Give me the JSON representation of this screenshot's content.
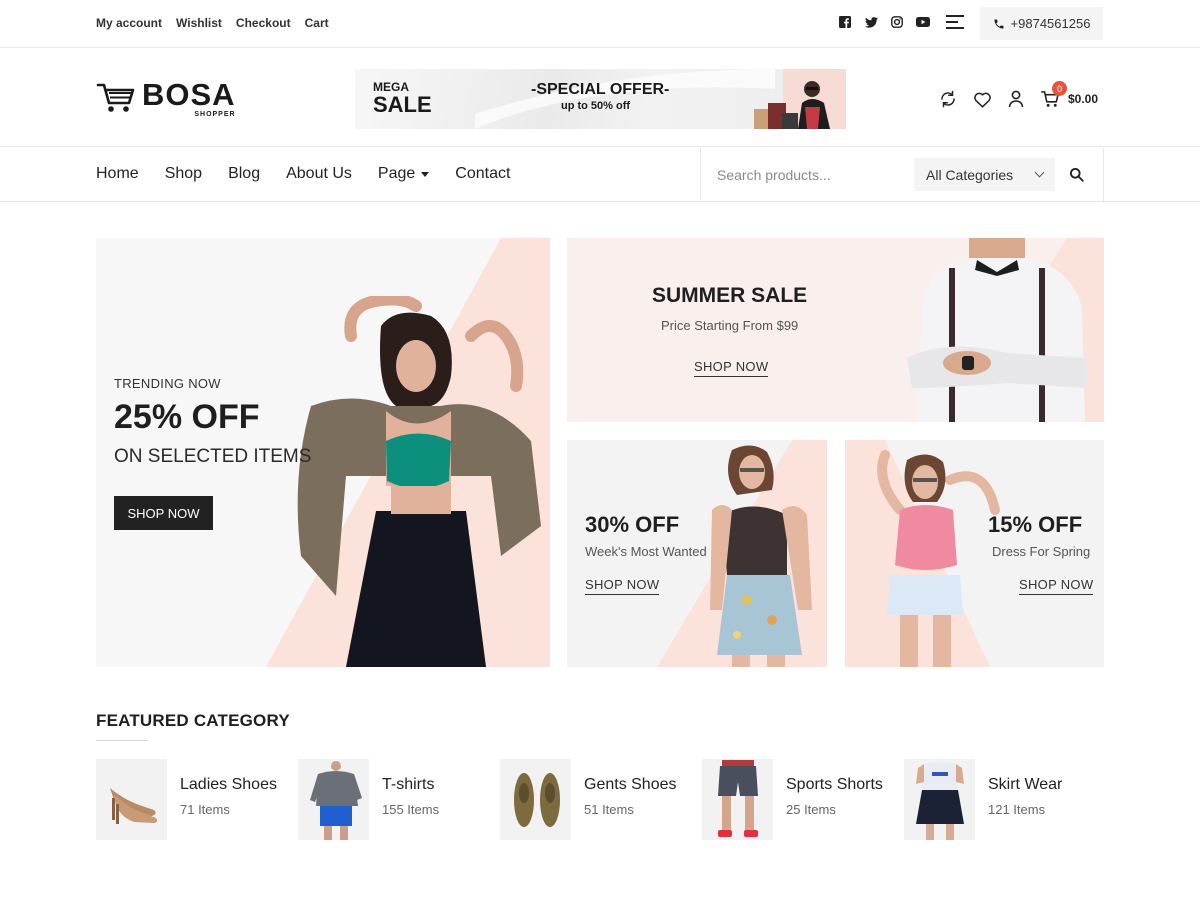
{
  "topbar": {
    "links": [
      "My account",
      "Wishlist",
      "Checkout",
      "Cart"
    ],
    "social_icons": [
      "facebook-icon",
      "twitter-icon",
      "instagram-icon",
      "youtube-icon"
    ],
    "phone": "+9874561256"
  },
  "header": {
    "logo_main": "BOSA",
    "logo_sub": "SHOPPER",
    "promo": {
      "mega": "MEGA",
      "sale": "SALE",
      "offer": "-SPECIAL OFFER-",
      "upto": "up to 50% off"
    },
    "cart_count": "0",
    "cart_total": "$0.00"
  },
  "nav": {
    "items": [
      "Home",
      "Shop",
      "Blog",
      "About Us",
      "Page",
      "Contact"
    ],
    "search_placeholder": "Search products...",
    "category_selected": "All Categories"
  },
  "banners": {
    "main": {
      "eyebrow": "TRENDING NOW",
      "title": "25% OFF",
      "subtitle": "ON SELECTED ITEMS",
      "button": "SHOP NOW"
    },
    "summer": {
      "title": "SUMMER SALE",
      "subtitle": "Price Starting From $99",
      "button": "SHOP NOW"
    },
    "week": {
      "title": "30% OFF",
      "subtitle": "Week's Most Wanted",
      "button": "SHOP NOW"
    },
    "spring": {
      "title": "15% OFF",
      "subtitle": "Dress For Spring",
      "button": "SHOP NOW"
    }
  },
  "featured": {
    "title": "FEATURED CATEGORY",
    "categories": [
      {
        "name": "Ladies Shoes",
        "count": "71 Items"
      },
      {
        "name": "T-shirts",
        "count": "155 Items"
      },
      {
        "name": "Gents Shoes",
        "count": "51 Items"
      },
      {
        "name": "Sports Shorts",
        "count": "25 Items"
      },
      {
        "name": "Skirt Wear",
        "count": "121 Items"
      }
    ]
  },
  "colors": {
    "accent_pink": "#f9ddd6",
    "badge": "#e8533d",
    "dark": "#222222"
  }
}
